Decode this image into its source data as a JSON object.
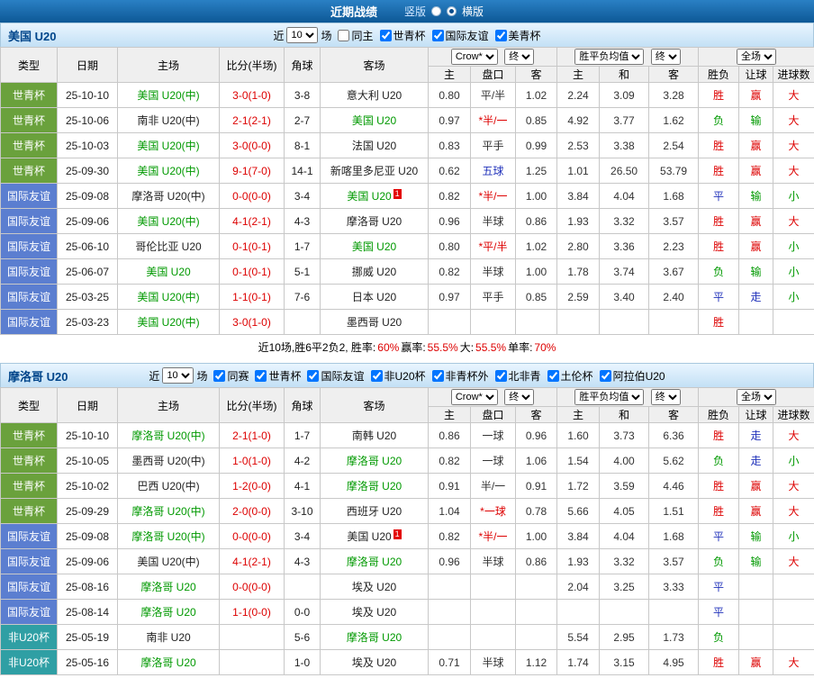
{
  "topbar": {
    "title": "近期战绩",
    "vertical_label": "竖版",
    "horizontal_label": "横版"
  },
  "columns": {
    "type": "类型",
    "date": "日期",
    "home": "主场",
    "score": "比分(半场)",
    "corner": "角球",
    "away": "客场",
    "h_home": "主",
    "h_hc": "盘口",
    "h_away": "客",
    "a_home": "主",
    "a_draw": "和",
    "a_away": "客",
    "r_result": "胜负",
    "r_let": "让球",
    "r_goal": "进球数"
  },
  "controls": {
    "crow": "Crow*",
    "final": "终",
    "avg": "胜平负均值",
    "full": "全场"
  },
  "colors": {
    "red": "#dd0000",
    "green": "#009900",
    "blue": "#2233bb",
    "lg": "#6aa13c",
    "lb": "#5b7ed0",
    "lt": "#2f9fa4",
    "topbar1": "#2a80c4",
    "topbar2": "#0d5896",
    "secbg1": "#e9f5ff",
    "secbg2": "#c3e0f5",
    "navy": "#00458a",
    "headbg": "#efefef",
    "border": "#c8c8c8",
    "card": "#e30000"
  },
  "type_classes": {
    "世青杯": "lt-green",
    "国际友谊": "lt-blue",
    "非U20杯": "lt-teal"
  },
  "value_colors": {
    "胜": "red",
    "负": "green",
    "平": "blue",
    "赢": "red",
    "输": "green",
    "走": "blue",
    "大": "red",
    "小": "green"
  },
  "sections": [
    {
      "team": "美国 U20",
      "subject": "美国",
      "filters": {
        "near_label": "近",
        "count": "10",
        "games_label": "场",
        "options": [
          {
            "label": "同主",
            "checked": false
          },
          {
            "label": "世青杯",
            "checked": true
          },
          {
            "label": "国际友谊",
            "checked": true
          },
          {
            "label": "美青杯",
            "checked": true
          }
        ]
      },
      "rows": [
        {
          "type": "世青杯",
          "date": "25-10-10",
          "home": "美国 U20(中)",
          "score": "3-0(1-0)",
          "corner": "3-8",
          "away": "意大利 U20",
          "odds": [
            "0.80",
            "平/半",
            "1.02"
          ],
          "avg": [
            "2.24",
            "3.09",
            "3.28"
          ],
          "result": "胜",
          "let": "赢",
          "goal": "大"
        },
        {
          "type": "世青杯",
          "date": "25-10-06",
          "home": "南非 U20(中)",
          "score": "2-1(2-1)",
          "corner": "2-7",
          "away": "美国 U20",
          "odds": [
            "0.97",
            "*半/一",
            "0.85"
          ],
          "avg": [
            "4.92",
            "3.77",
            "1.62"
          ],
          "result": "负",
          "let": "输",
          "goal": "大"
        },
        {
          "type": "世青杯",
          "date": "25-10-03",
          "home": "美国 U20(中)",
          "score": "3-0(0-0)",
          "corner": "8-1",
          "away": "法国 U20",
          "odds": [
            "0.83",
            "平手",
            "0.99"
          ],
          "avg": [
            "2.53",
            "3.38",
            "2.54"
          ],
          "result": "胜",
          "let": "赢",
          "goal": "大"
        },
        {
          "type": "世青杯",
          "date": "25-09-30",
          "home": "美国 U20(中)",
          "score": "9-1(7-0)",
          "corner": "14-1",
          "away": "新喀里多尼亚 U20",
          "odds": [
            "0.62",
            "五球",
            "1.25"
          ],
          "hc_cls": "blue",
          "avg": [
            "1.01",
            "26.50",
            "53.79"
          ],
          "result": "胜",
          "let": "赢",
          "goal": "大"
        },
        {
          "type": "国际友谊",
          "date": "25-09-08",
          "home": "摩洛哥 U20(中)",
          "score": "0-0(0-0)",
          "corner": "3-4",
          "away": "美国 U20",
          "away_card": "1",
          "odds": [
            "0.82",
            "*半/一",
            "1.00"
          ],
          "avg": [
            "3.84",
            "4.04",
            "1.68"
          ],
          "result": "平",
          "let": "输",
          "goal": "小"
        },
        {
          "type": "国际友谊",
          "date": "25-09-06",
          "home": "美国 U20(中)",
          "score": "4-1(2-1)",
          "corner": "4-3",
          "away": "摩洛哥 U20",
          "odds": [
            "0.96",
            "半球",
            "0.86"
          ],
          "avg": [
            "1.93",
            "3.32",
            "3.57"
          ],
          "result": "胜",
          "let": "赢",
          "goal": "大"
        },
        {
          "type": "国际友谊",
          "date": "25-06-10",
          "home": "哥伦比亚 U20",
          "score": "0-1(0-1)",
          "corner": "1-7",
          "away": "美国 U20",
          "odds": [
            "0.80",
            "*平/半",
            "1.02"
          ],
          "avg": [
            "2.80",
            "3.36",
            "2.23"
          ],
          "result": "胜",
          "let": "赢",
          "goal": "小"
        },
        {
          "type": "国际友谊",
          "date": "25-06-07",
          "home": "美国 U20",
          "score": "0-1(0-1)",
          "corner": "5-1",
          "away": "挪威 U20",
          "odds": [
            "0.82",
            "半球",
            "1.00"
          ],
          "avg": [
            "1.78",
            "3.74",
            "3.67"
          ],
          "result": "负",
          "let": "输",
          "goal": "小"
        },
        {
          "type": "国际友谊",
          "date": "25-03-25",
          "home": "美国 U20(中)",
          "score": "1-1(0-1)",
          "corner": "7-6",
          "away": "日本 U20",
          "odds": [
            "0.97",
            "平手",
            "0.85"
          ],
          "avg": [
            "2.59",
            "3.40",
            "2.40"
          ],
          "result": "平",
          "let": "走",
          "goal": "小"
        },
        {
          "type": "国际友谊",
          "date": "25-03-23",
          "home": "美国 U20(中)",
          "score": "3-0(1-0)",
          "corner": "",
          "away": "墨西哥 U20",
          "odds": [
            "",
            "",
            ""
          ],
          "avg": [
            "",
            "",
            ""
          ],
          "result": "胜",
          "let": "",
          "goal": ""
        }
      ],
      "summary": [
        {
          "t": "近10场,胜6平2负2, 胜率:"
        },
        {
          "t": "60%",
          "c": "red"
        },
        {
          "t": " 赢率:"
        },
        {
          "t": "55.5%",
          "c": "red"
        },
        {
          "t": " 大:"
        },
        {
          "t": "55.5%",
          "c": "red"
        },
        {
          "t": " 单率:"
        },
        {
          "t": "70%",
          "c": "red"
        }
      ]
    },
    {
      "team": "摩洛哥 U20",
      "subject": "摩洛哥",
      "filters": {
        "near_label": "近",
        "count": "10",
        "games_label": "场",
        "options": [
          {
            "label": "同赛",
            "checked": true
          },
          {
            "label": "世青杯",
            "checked": true
          },
          {
            "label": "国际友谊",
            "checked": true
          },
          {
            "label": "非U20杯",
            "checked": true
          },
          {
            "label": "非青杯外",
            "checked": true
          },
          {
            "label": "北非青",
            "checked": true
          },
          {
            "label": "土伦杯",
            "checked": true
          },
          {
            "label": "阿拉伯U20",
            "checked": true
          }
        ]
      },
      "rows": [
        {
          "type": "世青杯",
          "date": "25-10-10",
          "home": "摩洛哥 U20(中)",
          "score": "2-1(1-0)",
          "corner": "1-7",
          "away": "南韩 U20",
          "odds": [
            "0.86",
            "一球",
            "0.96"
          ],
          "avg": [
            "1.60",
            "3.73",
            "6.36"
          ],
          "result": "胜",
          "let": "走",
          "goal": "大"
        },
        {
          "type": "世青杯",
          "date": "25-10-05",
          "home": "墨西哥 U20(中)",
          "score": "1-0(1-0)",
          "corner": "4-2",
          "away": "摩洛哥 U20",
          "odds": [
            "0.82",
            "一球",
            "1.06"
          ],
          "avg": [
            "1.54",
            "4.00",
            "5.62"
          ],
          "result": "负",
          "let": "走",
          "goal": "小"
        },
        {
          "type": "世青杯",
          "date": "25-10-02",
          "home": "巴西 U20(中)",
          "score": "1-2(0-0)",
          "corner": "4-1",
          "away": "摩洛哥 U20",
          "odds": [
            "0.91",
            "半/一",
            "0.91"
          ],
          "avg": [
            "1.72",
            "3.59",
            "4.46"
          ],
          "result": "胜",
          "let": "赢",
          "goal": "大"
        },
        {
          "type": "世青杯",
          "date": "25-09-29",
          "home": "摩洛哥 U20(中)",
          "score": "2-0(0-0)",
          "corner": "3-10",
          "away": "西班牙 U20",
          "odds": [
            "1.04",
            "*一球",
            "0.78"
          ],
          "avg": [
            "5.66",
            "4.05",
            "1.51"
          ],
          "result": "胜",
          "let": "赢",
          "goal": "大"
        },
        {
          "type": "国际友谊",
          "date": "25-09-08",
          "home": "摩洛哥 U20(中)",
          "score": "0-0(0-0)",
          "corner": "3-4",
          "away": "美国 U20",
          "away_card": "1",
          "odds": [
            "0.82",
            "*半/一",
            "1.00"
          ],
          "avg": [
            "3.84",
            "4.04",
            "1.68"
          ],
          "result": "平",
          "let": "输",
          "goal": "小"
        },
        {
          "type": "国际友谊",
          "date": "25-09-06",
          "home": "美国 U20(中)",
          "score": "4-1(2-1)",
          "corner": "4-3",
          "away": "摩洛哥 U20",
          "odds": [
            "0.96",
            "半球",
            "0.86"
          ],
          "avg": [
            "1.93",
            "3.32",
            "3.57"
          ],
          "result": "负",
          "let": "输",
          "goal": "大"
        },
        {
          "type": "国际友谊",
          "date": "25-08-16",
          "home": "摩洛哥 U20",
          "score": "0-0(0-0)",
          "corner": "",
          "away": "埃及 U20",
          "odds": [
            "",
            "",
            ""
          ],
          "avg": [
            "2.04",
            "3.25",
            "3.33"
          ],
          "result": "平",
          "let": "",
          "goal": ""
        },
        {
          "type": "国际友谊",
          "date": "25-08-14",
          "home": "摩洛哥 U20",
          "score": "1-1(0-0)",
          "corner": "0-0",
          "away": "埃及 U20",
          "odds": [
            "",
            "",
            ""
          ],
          "avg": [
            "",
            "",
            ""
          ],
          "result": "平",
          "let": "",
          "goal": ""
        },
        {
          "type": "非U20杯",
          "date": "25-05-19",
          "home": "南非 U20",
          "score": "",
          "corner": "5-6",
          "away": "摩洛哥 U20",
          "odds": [
            "",
            "",
            ""
          ],
          "avg": [
            "5.54",
            "2.95",
            "1.73"
          ],
          "result": "负",
          "let": "",
          "goal": ""
        },
        {
          "type": "非U20杯",
          "date": "25-05-16",
          "home": "摩洛哥 U20",
          "score": "",
          "corner": "1-0",
          "away": "埃及 U20",
          "odds": [
            "0.71",
            "半球",
            "1.12"
          ],
          "avg": [
            "1.74",
            "3.15",
            "4.95"
          ],
          "result": "胜",
          "let": "赢",
          "goal": "大"
        }
      ]
    }
  ]
}
